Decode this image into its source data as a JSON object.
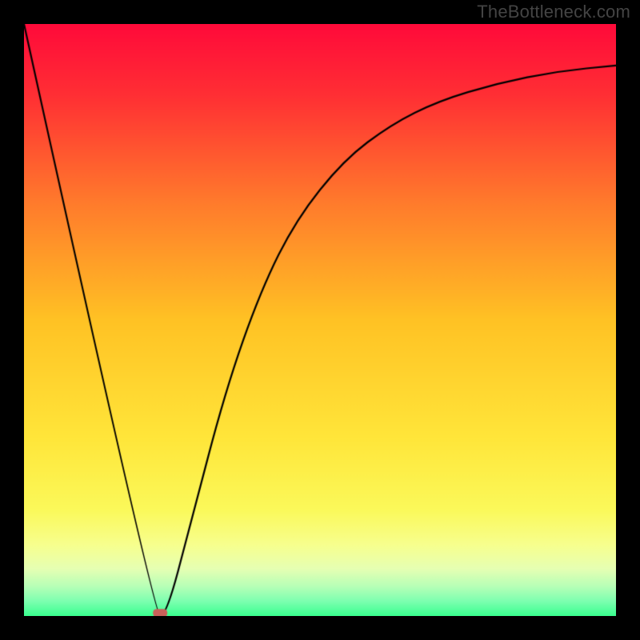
{
  "watermark": "TheBottleneck.com",
  "chart_data": {
    "type": "line",
    "title": "",
    "xlabel": "",
    "ylabel": "",
    "xlim": [
      0,
      1
    ],
    "ylim": [
      0,
      1
    ],
    "series": [
      {
        "name": "bottleneck-curve",
        "points": [
          {
            "x": 0.0,
            "y": 1.0
          },
          {
            "x": 0.22,
            "y": 0.0
          },
          {
            "x": 0.24,
            "y": 0.0
          },
          {
            "x": 0.28,
            "y": 0.15
          },
          {
            "x": 0.34,
            "y": 0.38
          },
          {
            "x": 0.4,
            "y": 0.55
          },
          {
            "x": 0.46,
            "y": 0.67
          },
          {
            "x": 0.54,
            "y": 0.77
          },
          {
            "x": 0.62,
            "y": 0.83
          },
          {
            "x": 0.7,
            "y": 0.87
          },
          {
            "x": 0.8,
            "y": 0.9
          },
          {
            "x": 0.9,
            "y": 0.92
          },
          {
            "x": 1.0,
            "y": 0.93
          }
        ]
      }
    ],
    "optimal_marker": {
      "x": 0.23,
      "y": 0.005
    },
    "gradient_stops": [
      {
        "pos": 0.0,
        "color": "#ff0a3a"
      },
      {
        "pos": 0.12,
        "color": "#ff2f34"
      },
      {
        "pos": 0.3,
        "color": "#ff7a2c"
      },
      {
        "pos": 0.5,
        "color": "#ffc224"
      },
      {
        "pos": 0.7,
        "color": "#ffe63a"
      },
      {
        "pos": 0.82,
        "color": "#fbf95a"
      },
      {
        "pos": 0.88,
        "color": "#f7ff8e"
      },
      {
        "pos": 0.92,
        "color": "#e6ffb3"
      },
      {
        "pos": 0.95,
        "color": "#b7ffb7"
      },
      {
        "pos": 0.975,
        "color": "#7dffb0"
      },
      {
        "pos": 1.0,
        "color": "#39ff8f"
      }
    ]
  }
}
